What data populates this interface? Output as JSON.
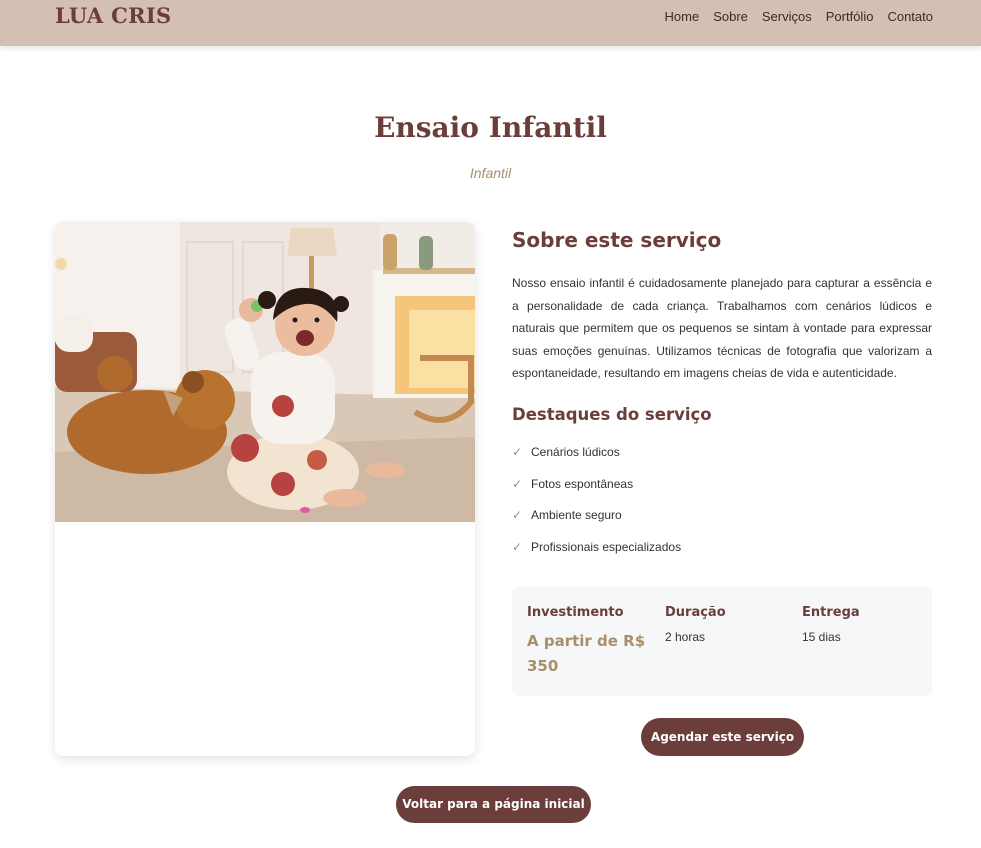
{
  "header": {
    "logo": "LUA CRIS",
    "nav": [
      "Home",
      "Sobre",
      "Serviços",
      "Portfólio",
      "Contato"
    ]
  },
  "page": {
    "title": "Ensaio Infantil",
    "subtitle": "Infantil"
  },
  "about": {
    "title": "Sobre este serviço",
    "description": "Nosso ensaio infantil é cuidadosamente planejado para capturar a essência e a personalidade de cada criança. Trabalhamos com cenários lúdicos e naturais que permitem que os pequenos se sintam à vontade para expressar suas emoções genuínas. Utilizamos técnicas de fotografia que valorizam a espontaneidade, resultando em imagens cheias de vida e autenticidade."
  },
  "highlights": {
    "title": "Destaques do serviço",
    "check": "✓",
    "items": [
      "Cenários lúdicos",
      "Fotos espontâneas",
      "Ambiente seguro",
      "Profissionais especializados"
    ]
  },
  "info": {
    "investment_label": "Investimento",
    "investment_value": "A partir de R$ 350",
    "duration_label": "Duração",
    "duration_value": "2 horas",
    "delivery_label": "Entrega",
    "delivery_value": "15 dias"
  },
  "buttons": {
    "book": "Agendar este serviço",
    "back": "Voltar para a página inicial"
  },
  "colors": {
    "header_bg": "#d4bfb4",
    "brand": "#6b3d3b",
    "accent_gold": "#a98e6a",
    "info_bg": "#f6f7f8"
  },
  "icons": {
    "check": "check-icon"
  }
}
